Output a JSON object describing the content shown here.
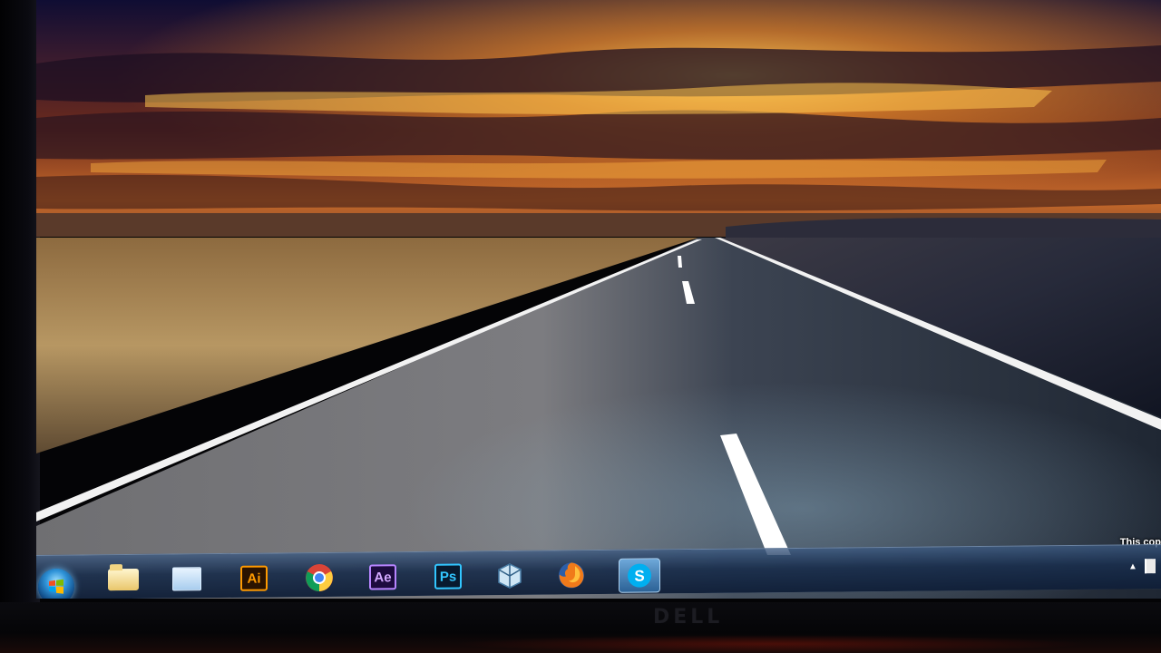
{
  "desktop": {
    "watermark_text": "This cop"
  },
  "taskbar": {
    "start_button": "start-orb",
    "pinned": [
      {
        "name": "folder-icon",
        "label": ""
      },
      {
        "name": "window-icon",
        "label": ""
      },
      {
        "name": "illustrator-icon",
        "label": "Ai",
        "color": "#ff9a00",
        "bg": "#2b1300"
      },
      {
        "name": "chrome-icon",
        "label": ""
      },
      {
        "name": "after-effects-icon",
        "label": "Ae",
        "color": "#d3a9ff",
        "bg": "#1d0b3f"
      },
      {
        "name": "photoshop-icon",
        "label": "Ps",
        "color": "#32c6ff",
        "bg": "#081a2e"
      },
      {
        "name": "3d-box-icon",
        "label": ""
      },
      {
        "name": "firefox-icon",
        "label": ""
      },
      {
        "name": "skype-icon",
        "label": "",
        "active": true
      }
    ],
    "tray": {
      "show_hidden_icon": "▲"
    }
  },
  "colors": {
    "taskbar_accent": "#3c5a82",
    "skype_blue": "#00aff0"
  }
}
